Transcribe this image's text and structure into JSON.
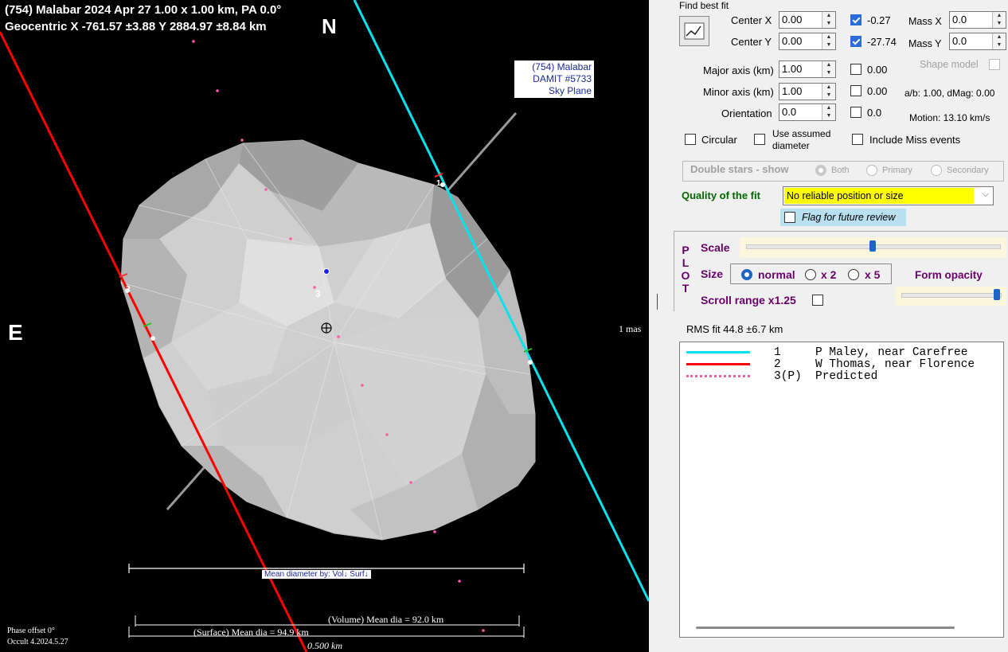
{
  "plot": {
    "header_line1": "(754) Malabar  2024 Apr 27   1.00 x 1.00 km,  PA 0.0°",
    "header_line2": "Geocentric  X  -761.57 ±3.88  Y 2884.97 ±8.84 km",
    "north_label": "N",
    "east_label": "E",
    "sky_box": [
      "(754) Malabar",
      "DAMIT #5733",
      "Sky Plane"
    ],
    "mas_label": "1 mas",
    "mean_dia_by": "Mean diameter by: Vol↓ Surf↓",
    "volume_label": "(Volume) Mean dia = 92.0 km",
    "surface_label": "(Surface) Mean dia = 94.9 km",
    "scale_label": "0.500 km",
    "phase_offset": "Phase offset 0°",
    "version": "Occult 4.2024.5.27",
    "chord_labels": {
      "c1": "1",
      "c2": "2",
      "c3": "3"
    },
    "colors": {
      "chord1": "#00e5ee",
      "chord2": "#ff0000",
      "predicted": "#ff5aa5",
      "shape": "#c4c4c4"
    }
  },
  "panel": {
    "find_best_fit": "Find best fit",
    "center_x_label": "Center X",
    "center_x_value": "0.00",
    "center_x_checked_value": "-0.27",
    "center_y_label": "Center Y",
    "center_y_value": "0.00",
    "center_y_checked_value": "-27.74",
    "mass_x_label": "Mass X",
    "mass_x_value": "0.0",
    "mass_y_label": "Mass Y",
    "mass_y_value": "0.0",
    "shape_model_label": "Shape model",
    "major_axis_label": "Major axis (km)",
    "major_axis_value": "1.00",
    "major_axis_cb": "0.00",
    "minor_axis_label": "Minor axis (km)",
    "minor_axis_value": "1.00",
    "minor_axis_cb": "0.00",
    "ab_label": "a/b: 1.00, dMag: 0.00",
    "orientation_label": "Orientation",
    "orientation_value": "0.0",
    "orientation_cb": "0.0",
    "motion_label": "Motion: 13.10 km/s",
    "circular_label": "Circular",
    "use_assumed_label_1": "Use assumed",
    "use_assumed_label_2": "diameter",
    "include_miss_label": "Include Miss events",
    "double_stars_label": "Double stars - show",
    "ds_both": "Both",
    "ds_primary": "Primary",
    "ds_secondary": "Secondary",
    "quality_label": "Quality of the fit",
    "quality_value": "No reliable position or size",
    "flag_label": "Flag for future review",
    "plot_letters": [
      "P",
      "L",
      "O",
      "T"
    ],
    "scale_label": "Scale",
    "size_label": "Size",
    "size_normal": "normal",
    "size_x2": "x 2",
    "size_x5": "x 5",
    "form_opacity_label": "Form opacity",
    "scroll_range_label": "Scroll range x1.25",
    "scale_slider_fraction": 0.5,
    "opacity_slider_fraction": 0.97,
    "rms_label": "RMS fit 44.8 ±6.7 km",
    "legend": [
      {
        "num": "1",
        "name": "P Maley, near Carefree",
        "color": "#00e5ee",
        "style": "solid"
      },
      {
        "num": "2",
        "name": "W Thomas, near Florence",
        "color": "#ff0000",
        "style": "solid"
      },
      {
        "num": "3(P)",
        "name": "Predicted",
        "color": "#ff5aa5",
        "style": "dotted"
      }
    ],
    "colors": {
      "quality_bg": "#ffff00",
      "flag_bg": "#b8e0f0"
    }
  }
}
